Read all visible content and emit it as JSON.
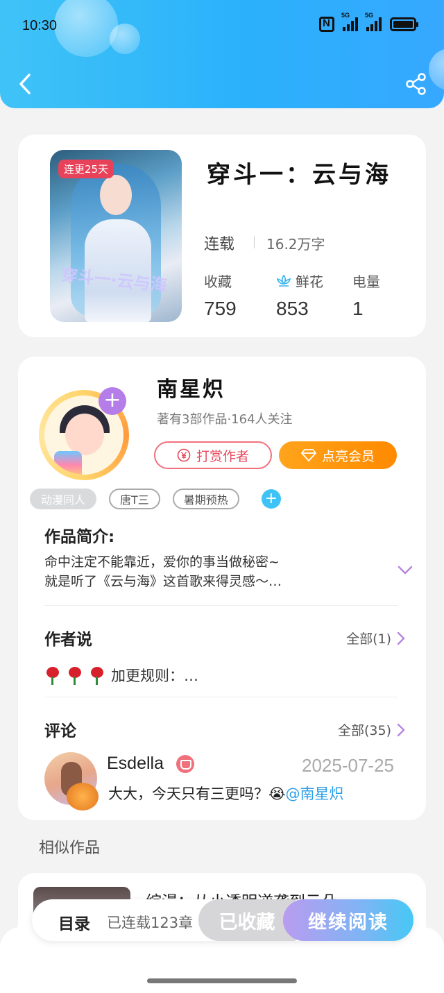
{
  "status": {
    "time": "10:30",
    "sig1_tag": "5G",
    "sig2_tag": "5G"
  },
  "book": {
    "badge": "连更25天",
    "cover_text": "穿斗一·云与海",
    "title": "穿斗一：云与海",
    "status": "连载",
    "word_count": "16.2万字",
    "stats": [
      {
        "label": "收藏",
        "value": "759",
        "icon": ""
      },
      {
        "label": "鲜花",
        "value": "853",
        "icon": "lotus-icon"
      },
      {
        "label": "电量",
        "value": "1",
        "icon": ""
      }
    ]
  },
  "author": {
    "name": "南星炽",
    "meta": "著有3部作品·164人关注",
    "tip_label": "打赏作者",
    "vip_label": "点亮会员",
    "tags": [
      "动漫同人",
      "唐T三",
      "暑期预热"
    ]
  },
  "intro": {
    "title": "作品简介:",
    "line1": "命中注定不能靠近，爱你的事当做秘密~",
    "line2": "就是听了《云与海》这首歌来得灵感～…"
  },
  "author_say": {
    "title": "作者说",
    "see_all": "全部(1)",
    "text": "加更规则：…"
  },
  "comments": {
    "title": "评论",
    "see_all": "全部(35)",
    "user": "Esdella",
    "date": "2025-07-25",
    "text": "大大，今天只有三更吗？😭",
    "mention": "@南星炽"
  },
  "similar": {
    "title": "相似作品",
    "item_name": "综漫：从小透明逆袭到云朵"
  },
  "bottom": {
    "catalog": "目录",
    "chapters": "已连载123章",
    "fav_label": "已收藏",
    "read_label": "继续阅读"
  },
  "colors": {
    "header_blue": "#2bb1fb",
    "tip_red": "#e8485a",
    "vip_orange": "#ff8a00",
    "mention_blue": "#2a9ee6"
  }
}
